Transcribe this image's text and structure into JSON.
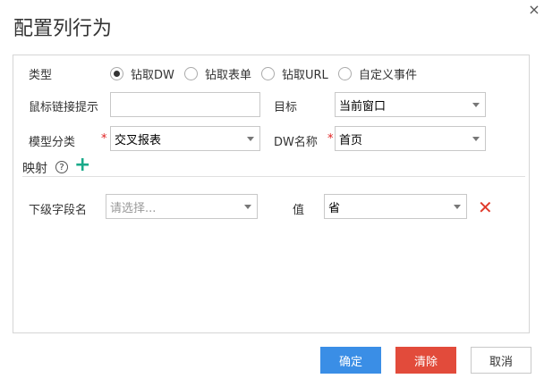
{
  "dialog": {
    "title": "配置列行为",
    "close_glyph": "×"
  },
  "form": {
    "type_label": "类型",
    "type_options": [
      "钻取DW",
      "钻取表单",
      "钻取URL",
      "自定义事件"
    ],
    "type_selected": "钻取DW",
    "tooltip_label": "鼠标链接提示",
    "tooltip_value": "",
    "target_label": "目标",
    "target_value": "当前窗口",
    "model_label": "模型分类",
    "model_value": "交叉报表",
    "dw_label": "DW名称",
    "dw_value": "首页",
    "required_mark": "*"
  },
  "mapping": {
    "title": "映射",
    "help_glyph": "?",
    "add_glyph": "+",
    "rows": [
      {
        "field_label": "下级字段名",
        "field_placeholder": "请选择...",
        "value_label": "值",
        "value_selected": "省",
        "delete_glyph": "✕"
      }
    ]
  },
  "footer": {
    "confirm_label": "确定",
    "clear_label": "清除",
    "cancel_label": "取消"
  },
  "colors": {
    "primary": "#3a8ee6",
    "danger": "#e24b3b",
    "add": "#1aaa8a",
    "required": "#e02020"
  }
}
